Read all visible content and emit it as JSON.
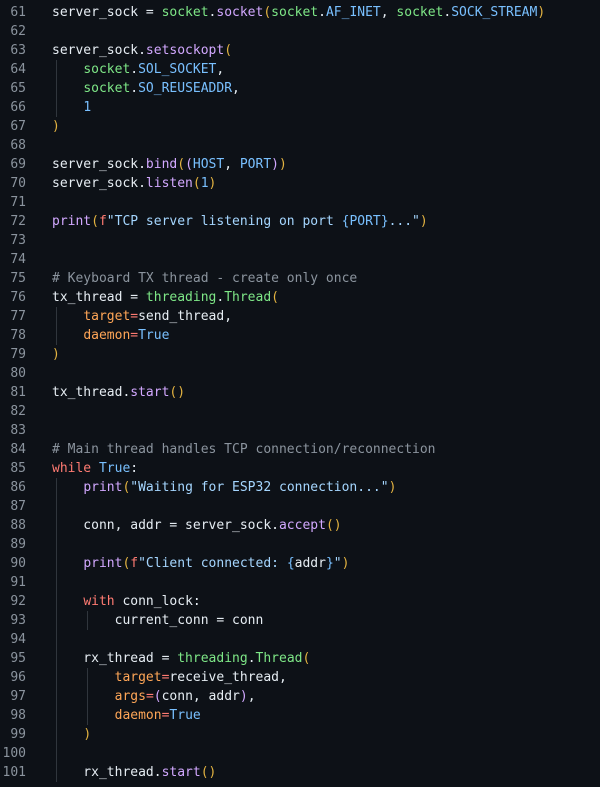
{
  "editor": {
    "language": "python",
    "colors": {
      "background": "#0d1117",
      "line_number": "#8b949e",
      "plain": "#e6edf3",
      "function": "#d2a8ff",
      "module": "#7ee787",
      "constant": "#79c0ff",
      "keyword": "#ff7b72",
      "string": "#a5d6ff",
      "comment": "#8b949e",
      "parameter": "#ffa657",
      "bracket_level_1": "#e3b341",
      "bracket_level_2": "#d2a8ff",
      "bracket_level_3": "#79c0ff"
    },
    "lines": [
      {
        "number": "61",
        "indent": 0,
        "tokens": [
          {
            "t": "plain",
            "v": "server_sock = "
          },
          {
            "t": "mod",
            "v": "socket"
          },
          {
            "t": "plain",
            "v": "."
          },
          {
            "t": "func",
            "v": "socket"
          },
          {
            "t": "b1",
            "v": "("
          },
          {
            "t": "mod",
            "v": "socket"
          },
          {
            "t": "plain",
            "v": "."
          },
          {
            "t": "const",
            "v": "AF_INET"
          },
          {
            "t": "plain",
            "v": ", "
          },
          {
            "t": "mod",
            "v": "socket"
          },
          {
            "t": "plain",
            "v": "."
          },
          {
            "t": "const",
            "v": "SOCK_STREAM"
          },
          {
            "t": "b1",
            "v": ")"
          }
        ]
      },
      {
        "number": "62",
        "indent": 0,
        "tokens": []
      },
      {
        "number": "63",
        "indent": 0,
        "tokens": [
          {
            "t": "plain",
            "v": "server_sock."
          },
          {
            "t": "func",
            "v": "setsockopt"
          },
          {
            "t": "b1",
            "v": "("
          }
        ]
      },
      {
        "number": "64",
        "indent": 1,
        "tokens": [
          {
            "t": "plain",
            "v": "    "
          },
          {
            "t": "mod",
            "v": "socket"
          },
          {
            "t": "plain",
            "v": "."
          },
          {
            "t": "const",
            "v": "SOL_SOCKET"
          },
          {
            "t": "plain",
            "v": ","
          }
        ]
      },
      {
        "number": "65",
        "indent": 1,
        "tokens": [
          {
            "t": "plain",
            "v": "    "
          },
          {
            "t": "mod",
            "v": "socket"
          },
          {
            "t": "plain",
            "v": "."
          },
          {
            "t": "const",
            "v": "SO_REUSEADDR"
          },
          {
            "t": "plain",
            "v": ","
          }
        ]
      },
      {
        "number": "66",
        "indent": 1,
        "tokens": [
          {
            "t": "plain",
            "v": "    "
          },
          {
            "t": "const",
            "v": "1"
          }
        ]
      },
      {
        "number": "67",
        "indent": 0,
        "tokens": [
          {
            "t": "b1",
            "v": ")"
          }
        ]
      },
      {
        "number": "68",
        "indent": 0,
        "tokens": []
      },
      {
        "number": "69",
        "indent": 0,
        "tokens": [
          {
            "t": "plain",
            "v": "server_sock."
          },
          {
            "t": "func",
            "v": "bind"
          },
          {
            "t": "b1",
            "v": "("
          },
          {
            "t": "b2",
            "v": "("
          },
          {
            "t": "const",
            "v": "HOST"
          },
          {
            "t": "plain",
            "v": ", "
          },
          {
            "t": "const",
            "v": "PORT"
          },
          {
            "t": "b2",
            "v": ")"
          },
          {
            "t": "b1",
            "v": ")"
          }
        ]
      },
      {
        "number": "70",
        "indent": 0,
        "tokens": [
          {
            "t": "plain",
            "v": "server_sock."
          },
          {
            "t": "func",
            "v": "listen"
          },
          {
            "t": "b1",
            "v": "("
          },
          {
            "t": "const",
            "v": "1"
          },
          {
            "t": "b1",
            "v": ")"
          }
        ]
      },
      {
        "number": "71",
        "indent": 0,
        "tokens": []
      },
      {
        "number": "72",
        "indent": 0,
        "tokens": [
          {
            "t": "func",
            "v": "print"
          },
          {
            "t": "b1",
            "v": "("
          },
          {
            "t": "kw",
            "v": "f"
          },
          {
            "t": "string",
            "v": "\"TCP server listening on port "
          },
          {
            "t": "interp",
            "v": "{"
          },
          {
            "t": "const",
            "v": "PORT"
          },
          {
            "t": "interp",
            "v": "}"
          },
          {
            "t": "string",
            "v": "...\""
          },
          {
            "t": "b1",
            "v": ")"
          }
        ]
      },
      {
        "number": "73",
        "indent": 0,
        "tokens": []
      },
      {
        "number": "74",
        "indent": 0,
        "tokens": []
      },
      {
        "number": "75",
        "indent": 0,
        "tokens": [
          {
            "t": "comment",
            "v": "# Keyboard TX thread - create only once"
          }
        ]
      },
      {
        "number": "76",
        "indent": 0,
        "tokens": [
          {
            "t": "plain",
            "v": "tx_thread = "
          },
          {
            "t": "mod",
            "v": "threading"
          },
          {
            "t": "plain",
            "v": "."
          },
          {
            "t": "mod",
            "v": "Thread"
          },
          {
            "t": "b1",
            "v": "("
          }
        ]
      },
      {
        "number": "77",
        "indent": 1,
        "tokens": [
          {
            "t": "plain",
            "v": "    "
          },
          {
            "t": "param",
            "v": "target"
          },
          {
            "t": "kw",
            "v": "="
          },
          {
            "t": "plain",
            "v": "send_thread,"
          }
        ]
      },
      {
        "number": "78",
        "indent": 1,
        "tokens": [
          {
            "t": "plain",
            "v": "    "
          },
          {
            "t": "param",
            "v": "daemon"
          },
          {
            "t": "kw",
            "v": "="
          },
          {
            "t": "const",
            "v": "True"
          }
        ]
      },
      {
        "number": "79",
        "indent": 0,
        "tokens": [
          {
            "t": "b1",
            "v": ")"
          }
        ]
      },
      {
        "number": "80",
        "indent": 0,
        "tokens": []
      },
      {
        "number": "81",
        "indent": 0,
        "tokens": [
          {
            "t": "plain",
            "v": "tx_thread."
          },
          {
            "t": "func",
            "v": "start"
          },
          {
            "t": "b1",
            "v": "()"
          }
        ]
      },
      {
        "number": "82",
        "indent": 0,
        "tokens": []
      },
      {
        "number": "83",
        "indent": 0,
        "tokens": []
      },
      {
        "number": "84",
        "indent": 0,
        "tokens": [
          {
            "t": "comment",
            "v": "# Main thread handles TCP connection/reconnection"
          }
        ]
      },
      {
        "number": "85",
        "indent": 0,
        "tokens": [
          {
            "t": "kw",
            "v": "while"
          },
          {
            "t": "plain",
            "v": " "
          },
          {
            "t": "const",
            "v": "True"
          },
          {
            "t": "plain",
            "v": ":"
          }
        ]
      },
      {
        "number": "86",
        "indent": 1,
        "tokens": [
          {
            "t": "plain",
            "v": "    "
          },
          {
            "t": "func",
            "v": "print"
          },
          {
            "t": "b1",
            "v": "("
          },
          {
            "t": "string",
            "v": "\"Waiting for ESP32 connection...\""
          },
          {
            "t": "b1",
            "v": ")"
          }
        ]
      },
      {
        "number": "87",
        "indent": 1,
        "tokens": []
      },
      {
        "number": "88",
        "indent": 1,
        "tokens": [
          {
            "t": "plain",
            "v": "    conn, addr = server_sock."
          },
          {
            "t": "func",
            "v": "accept"
          },
          {
            "t": "b1",
            "v": "()"
          }
        ]
      },
      {
        "number": "89",
        "indent": 1,
        "tokens": []
      },
      {
        "number": "90",
        "indent": 1,
        "tokens": [
          {
            "t": "plain",
            "v": "    "
          },
          {
            "t": "func",
            "v": "print"
          },
          {
            "t": "b1",
            "v": "("
          },
          {
            "t": "kw",
            "v": "f"
          },
          {
            "t": "string",
            "v": "\"Client connected: "
          },
          {
            "t": "interp",
            "v": "{"
          },
          {
            "t": "plain",
            "v": "addr"
          },
          {
            "t": "interp",
            "v": "}"
          },
          {
            "t": "string",
            "v": "\""
          },
          {
            "t": "b1",
            "v": ")"
          }
        ]
      },
      {
        "number": "91",
        "indent": 1,
        "tokens": []
      },
      {
        "number": "92",
        "indent": 1,
        "tokens": [
          {
            "t": "plain",
            "v": "    "
          },
          {
            "t": "kw",
            "v": "with"
          },
          {
            "t": "plain",
            "v": " conn_lock:"
          }
        ]
      },
      {
        "number": "93",
        "indent": 2,
        "tokens": [
          {
            "t": "plain",
            "v": "        current_conn = conn"
          }
        ]
      },
      {
        "number": "94",
        "indent": 1,
        "tokens": []
      },
      {
        "number": "95",
        "indent": 1,
        "tokens": [
          {
            "t": "plain",
            "v": "    rx_thread = "
          },
          {
            "t": "mod",
            "v": "threading"
          },
          {
            "t": "plain",
            "v": "."
          },
          {
            "t": "mod",
            "v": "Thread"
          },
          {
            "t": "b1",
            "v": "("
          }
        ]
      },
      {
        "number": "96",
        "indent": 2,
        "tokens": [
          {
            "t": "plain",
            "v": "        "
          },
          {
            "t": "param",
            "v": "target"
          },
          {
            "t": "kw",
            "v": "="
          },
          {
            "t": "plain",
            "v": "receive_thread,"
          }
        ]
      },
      {
        "number": "97",
        "indent": 2,
        "tokens": [
          {
            "t": "plain",
            "v": "        "
          },
          {
            "t": "param",
            "v": "args"
          },
          {
            "t": "kw",
            "v": "="
          },
          {
            "t": "b2",
            "v": "("
          },
          {
            "t": "plain",
            "v": "conn, addr"
          },
          {
            "t": "b2",
            "v": ")"
          },
          {
            "t": "plain",
            "v": ","
          }
        ]
      },
      {
        "number": "98",
        "indent": 2,
        "tokens": [
          {
            "t": "plain",
            "v": "        "
          },
          {
            "t": "param",
            "v": "daemon"
          },
          {
            "t": "kw",
            "v": "="
          },
          {
            "t": "const",
            "v": "True"
          }
        ]
      },
      {
        "number": "99",
        "indent": 1,
        "tokens": [
          {
            "t": "plain",
            "v": "    "
          },
          {
            "t": "b1",
            "v": ")"
          }
        ]
      },
      {
        "number": "100",
        "indent": 1,
        "tokens": []
      },
      {
        "number": "101",
        "indent": 1,
        "tokens": [
          {
            "t": "plain",
            "v": "    rx_thread."
          },
          {
            "t": "func",
            "v": "start"
          },
          {
            "t": "b1",
            "v": "()"
          }
        ]
      }
    ]
  }
}
